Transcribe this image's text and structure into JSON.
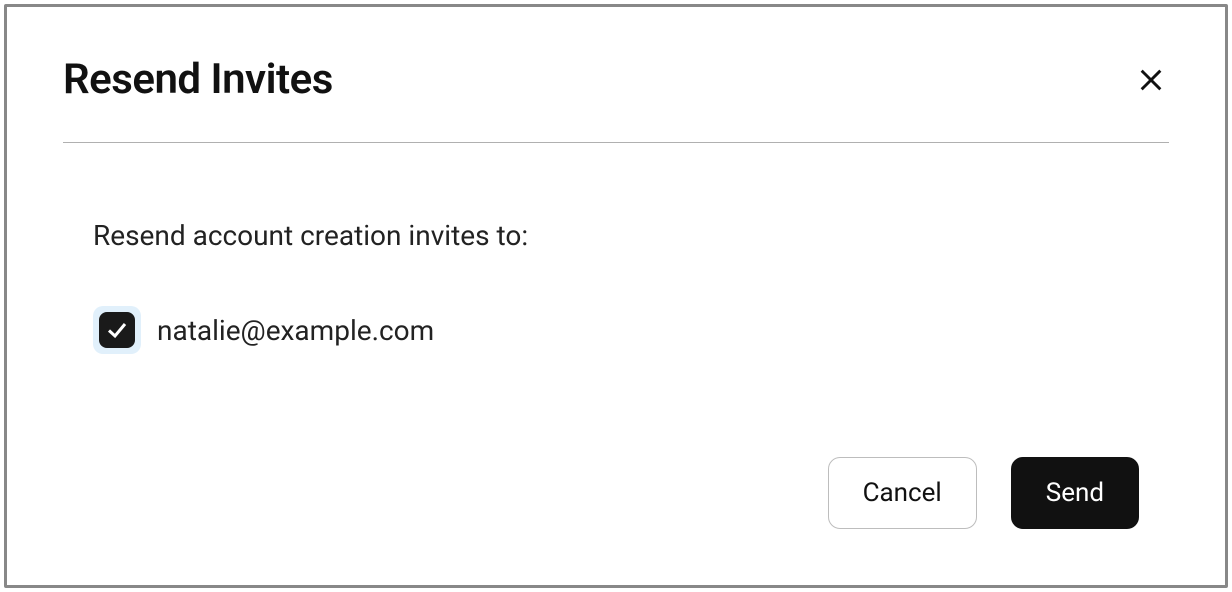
{
  "modal": {
    "title": "Resend Invites",
    "prompt": "Resend account creation invites to:",
    "invites": [
      {
        "email": "natalie@example.com",
        "checked": true
      }
    ],
    "buttons": {
      "cancel": "Cancel",
      "send": "Send"
    }
  }
}
